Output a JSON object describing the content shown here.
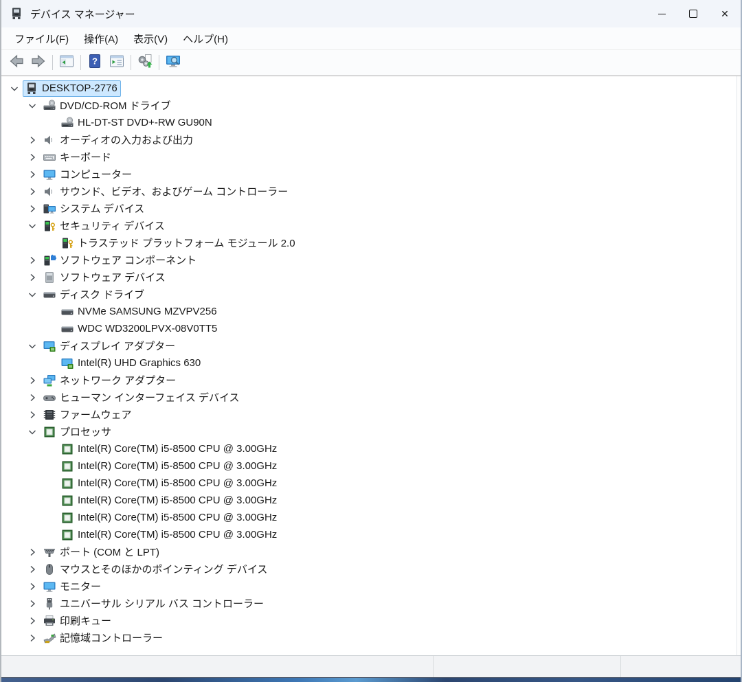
{
  "window": {
    "title": "デバイス マネージャー",
    "controls": {
      "minimize": "minimize",
      "maximize": "maximize",
      "close": "close"
    }
  },
  "menu_bar": {
    "items": [
      {
        "label": "ファイル(F)"
      },
      {
        "label": "操作(A)"
      },
      {
        "label": "表示(V)"
      },
      {
        "label": "ヘルプ(H)"
      }
    ]
  },
  "toolbar": {
    "buttons": [
      {
        "name": "back",
        "icon": "back-arrow-icon"
      },
      {
        "name": "forward",
        "icon": "forward-arrow-icon"
      },
      {
        "name": "show-console-tree",
        "icon": "console-tree-icon"
      },
      {
        "name": "help",
        "icon": "help-icon"
      },
      {
        "name": "properties",
        "icon": "properties-window-icon"
      },
      {
        "name": "scan-hardware-changes",
        "icon": "scan-hardware-icon"
      },
      {
        "name": "device-search",
        "icon": "monitor-search-icon"
      }
    ]
  },
  "tree": {
    "items": [
      {
        "level": 0,
        "state": "expanded",
        "icon": "computer-root-icon",
        "label": "DESKTOP-2776",
        "selected": true
      },
      {
        "level": 1,
        "state": "expanded",
        "icon": "dvd-drive-icon",
        "label": "DVD/CD-ROM ドライブ"
      },
      {
        "level": 2,
        "state": "leaf",
        "icon": "dvd-drive-icon",
        "label": "HL-DT-ST DVD+-RW GU90N"
      },
      {
        "level": 1,
        "state": "collapsed",
        "icon": "speaker-icon",
        "label": "オーディオの入力および出力"
      },
      {
        "level": 1,
        "state": "collapsed",
        "icon": "keyboard-icon",
        "label": "キーボード"
      },
      {
        "level": 1,
        "state": "collapsed",
        "icon": "monitor-icon",
        "label": "コンピューター"
      },
      {
        "level": 1,
        "state": "collapsed",
        "icon": "speaker-icon",
        "label": "サウンド、ビデオ、およびゲーム コントローラー"
      },
      {
        "level": 1,
        "state": "collapsed",
        "icon": "system-devices-icon",
        "label": "システム デバイス"
      },
      {
        "level": 1,
        "state": "expanded",
        "icon": "security-device-icon",
        "label": "セキュリティ デバイス"
      },
      {
        "level": 2,
        "state": "leaf",
        "icon": "security-device-icon",
        "label": "トラステッド プラットフォーム モジュール 2.0"
      },
      {
        "level": 1,
        "state": "collapsed",
        "icon": "software-component-icon",
        "label": "ソフトウェア コンポーネント"
      },
      {
        "level": 1,
        "state": "collapsed",
        "icon": "software-device-icon",
        "label": "ソフトウェア デバイス"
      },
      {
        "level": 1,
        "state": "expanded",
        "icon": "disk-drive-icon",
        "label": "ディスク ドライブ"
      },
      {
        "level": 2,
        "state": "leaf",
        "icon": "disk-drive-icon",
        "label": "NVMe SAMSUNG MZVPV256"
      },
      {
        "level": 2,
        "state": "leaf",
        "icon": "disk-drive-icon",
        "label": "WDC WD3200LPVX-08V0TT5"
      },
      {
        "level": 1,
        "state": "expanded",
        "icon": "display-adapter-icon",
        "label": "ディスプレイ アダプター"
      },
      {
        "level": 2,
        "state": "leaf",
        "icon": "display-adapter-icon",
        "label": "Intel(R) UHD Graphics 630"
      },
      {
        "level": 1,
        "state": "collapsed",
        "icon": "network-adapter-icon",
        "label": "ネットワーク アダプター"
      },
      {
        "level": 1,
        "state": "collapsed",
        "icon": "hid-icon",
        "label": "ヒューマン インターフェイス デバイス"
      },
      {
        "level": 1,
        "state": "collapsed",
        "icon": "firmware-icon",
        "label": "ファームウェア"
      },
      {
        "level": 1,
        "state": "expanded",
        "icon": "processor-icon",
        "label": "プロセッサ"
      },
      {
        "level": 2,
        "state": "leaf",
        "icon": "processor-icon",
        "label": "Intel(R) Core(TM) i5-8500 CPU @ 3.00GHz"
      },
      {
        "level": 2,
        "state": "leaf",
        "icon": "processor-icon",
        "label": "Intel(R) Core(TM) i5-8500 CPU @ 3.00GHz"
      },
      {
        "level": 2,
        "state": "leaf",
        "icon": "processor-icon",
        "label": "Intel(R) Core(TM) i5-8500 CPU @ 3.00GHz"
      },
      {
        "level": 2,
        "state": "leaf",
        "icon": "processor-icon",
        "label": "Intel(R) Core(TM) i5-8500 CPU @ 3.00GHz"
      },
      {
        "level": 2,
        "state": "leaf",
        "icon": "processor-icon",
        "label": "Intel(R) Core(TM) i5-8500 CPU @ 3.00GHz"
      },
      {
        "level": 2,
        "state": "leaf",
        "icon": "processor-icon",
        "label": "Intel(R) Core(TM) i5-8500 CPU @ 3.00GHz"
      },
      {
        "level": 1,
        "state": "collapsed",
        "icon": "serial-port-icon",
        "label": "ポート (COM と LPT)"
      },
      {
        "level": 1,
        "state": "collapsed",
        "icon": "mouse-icon",
        "label": "マウスとそのほかのポインティング デバイス"
      },
      {
        "level": 1,
        "state": "collapsed",
        "icon": "monitor-icon",
        "label": "モニター"
      },
      {
        "level": 1,
        "state": "collapsed",
        "icon": "usb-icon",
        "label": "ユニバーサル シリアル バス コントローラー"
      },
      {
        "level": 1,
        "state": "collapsed",
        "icon": "printer-icon",
        "label": "印刷キュー"
      },
      {
        "level": 1,
        "state": "collapsed",
        "icon": "storage-controller-icon",
        "label": "記憶域コントローラー"
      }
    ]
  },
  "status_bar": {
    "sections": [
      {
        "text": ""
      },
      {
        "text": ""
      },
      {
        "text": ""
      }
    ]
  },
  "colors": {
    "selection_fill": "#cde8ff",
    "selection_border": "#6fb2e8",
    "monitor_blue": "#2b7bc0",
    "monitor_blue_light": "#5cb8f2",
    "cpu_green": "#1f5423",
    "security_green": "#39c24e",
    "key_gold": "#d7a51c",
    "titlebar_bg": "#f2f5fa",
    "tree_bg": "#ffffff"
  }
}
